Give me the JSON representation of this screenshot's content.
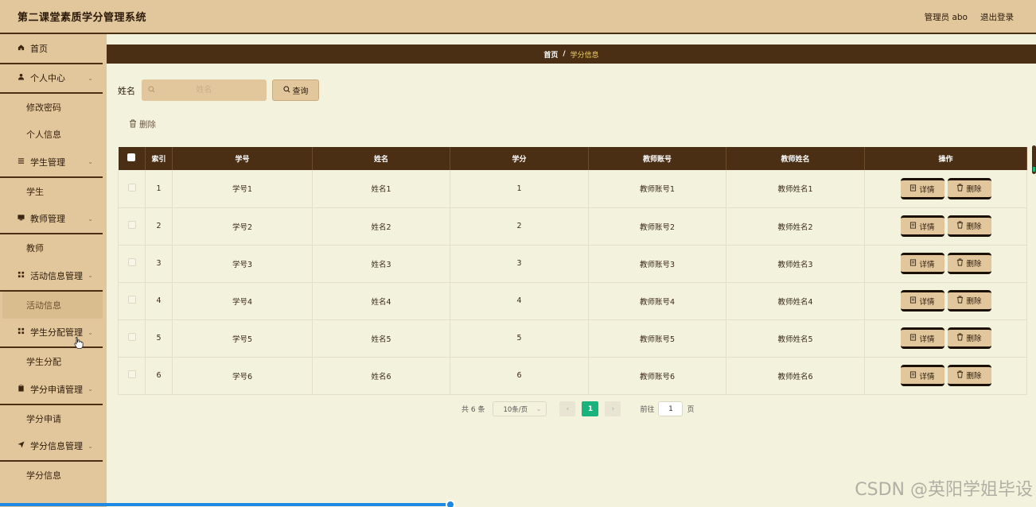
{
  "app": {
    "title": "第二课堂素质学分管理系统",
    "admin_label": "管理员 abo",
    "logout_label": "退出登录"
  },
  "sidebar": {
    "items": [
      {
        "label": "首页",
        "icon": "home-icon",
        "type": "menu"
      },
      {
        "label": "个人中心",
        "icon": "user-icon",
        "type": "menu",
        "expandable": true
      },
      {
        "label": "修改密码",
        "type": "sub"
      },
      {
        "label": "个人信息",
        "type": "sub"
      },
      {
        "label": "学生管理",
        "icon": "list-icon",
        "type": "menu",
        "expandable": true
      },
      {
        "label": "学生",
        "type": "sub"
      },
      {
        "label": "教师管理",
        "icon": "board-icon",
        "type": "menu",
        "expandable": true
      },
      {
        "label": "教师",
        "type": "sub"
      },
      {
        "label": "活动信息管理",
        "icon": "grid-icon",
        "type": "menu",
        "expandable": true
      },
      {
        "label": "活动信息",
        "type": "sub",
        "active": true
      },
      {
        "label": "学生分配管理",
        "icon": "grid-icon",
        "type": "menu",
        "expandable": true
      },
      {
        "label": "学生分配",
        "type": "sub"
      },
      {
        "label": "学分申请管理",
        "icon": "clipboard-icon",
        "type": "menu",
        "expandable": true
      },
      {
        "label": "学分申请",
        "type": "sub"
      },
      {
        "label": "学分信息管理",
        "icon": "send-icon",
        "type": "menu",
        "expandable": true
      },
      {
        "label": "学分信息",
        "type": "sub"
      }
    ]
  },
  "breadcrumb": {
    "home": "首页",
    "separator": "/",
    "current": "学分信息"
  },
  "search": {
    "label": "姓名",
    "placeholder": "姓名",
    "button_label": "查询"
  },
  "toolbar": {
    "delete_label": "删除"
  },
  "table": {
    "headers": [
      "索引",
      "学号",
      "姓名",
      "学分",
      "教师账号",
      "教师姓名",
      "操作"
    ],
    "rows": [
      {
        "index": "1",
        "xuehao": "学号1",
        "name": "姓名1",
        "credit": "1",
        "teacher_account": "教师账号1",
        "teacher_name": "教师姓名1"
      },
      {
        "index": "2",
        "xuehao": "学号2",
        "name": "姓名2",
        "credit": "2",
        "teacher_account": "教师账号2",
        "teacher_name": "教师姓名2"
      },
      {
        "index": "3",
        "xuehao": "学号3",
        "name": "姓名3",
        "credit": "3",
        "teacher_account": "教师账号3",
        "teacher_name": "教师姓名3"
      },
      {
        "index": "4",
        "xuehao": "学号4",
        "name": "姓名4",
        "credit": "4",
        "teacher_account": "教师账号4",
        "teacher_name": "教师姓名4"
      },
      {
        "index": "5",
        "xuehao": "学号5",
        "name": "姓名5",
        "credit": "5",
        "teacher_account": "教师账号5",
        "teacher_name": "教师姓名5"
      },
      {
        "index": "6",
        "xuehao": "学号6",
        "name": "姓名6",
        "credit": "6",
        "teacher_account": "教师账号6",
        "teacher_name": "教师姓名6"
      }
    ],
    "detail_label": "详情",
    "delete_label": "删除"
  },
  "pagination": {
    "total_label": "共 6 条",
    "page_size_label": "10条/页",
    "current_page": "1",
    "goto_label": "前往",
    "goto_value": "1",
    "page_suffix": "页"
  },
  "watermark": "CSDN @英阳学姐毕设",
  "colors": {
    "header_bg": "#e2c79c",
    "dark_brown": "#4a2f14",
    "content_bg": "#f3f2dc",
    "active_page": "#19b47e"
  }
}
